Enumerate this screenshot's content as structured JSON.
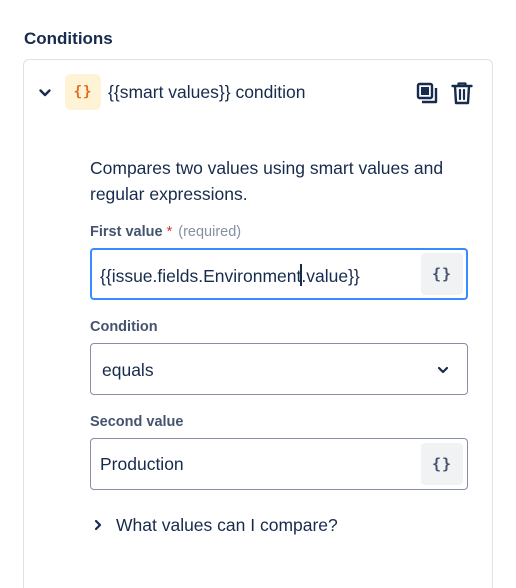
{
  "section": {
    "title": "Conditions"
  },
  "condition": {
    "icon": "smart-value-braces-icon",
    "icon_glyph": "{}",
    "title": "{{smart values}} condition",
    "description": "Compares two values using smart values and regular expressions.",
    "actions": {
      "copy_icon": "copy-icon",
      "delete_icon": "trash-icon"
    }
  },
  "first_value": {
    "label": "First value",
    "required_marker": "*",
    "required_text": "(required)",
    "value_before_caret": "{{issue.fields.Environment",
    "value_after_caret": ".value}}",
    "smart_button_glyph": "{}"
  },
  "condition_select": {
    "label": "Condition",
    "value": "equals"
  },
  "second_value": {
    "label": "Second value",
    "value": "Production",
    "smart_button_glyph": "{}"
  },
  "help": {
    "label": "What values can I compare?"
  },
  "colors": {
    "focus": "#388bff",
    "icon_bg": "#fff3d6",
    "icon_fg": "#e06c1b",
    "required": "#c9372c"
  }
}
